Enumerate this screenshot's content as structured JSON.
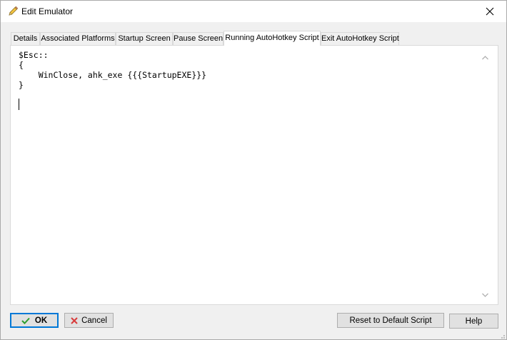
{
  "window": {
    "title": "Edit Emulator",
    "title_icon": "pencil-icon",
    "close_icon": "close-icon"
  },
  "tabs": [
    {
      "label": "Details",
      "active": false
    },
    {
      "label": "Associated Platforms",
      "active": false
    },
    {
      "label": "Startup Screen",
      "active": false
    },
    {
      "label": "Pause Screen",
      "active": false
    },
    {
      "label": "Running AutoHotkey Script",
      "active": true
    },
    {
      "label": "Exit AutoHotkey Script",
      "active": false
    }
  ],
  "editor": {
    "lines": [
      "$Esc::",
      "{",
      "    WinClose, ahk_exe {{{StartupEXE}}}",
      "}"
    ]
  },
  "buttons": {
    "ok": {
      "label": "OK",
      "icon": "checkmark-icon",
      "icon_color": "#2e9e2e"
    },
    "cancel": {
      "label": "Cancel",
      "icon": "x-icon",
      "icon_color": "#d83b3b"
    },
    "reset": {
      "label": "Reset to Default Script"
    },
    "help": {
      "label": "Help"
    }
  },
  "colors": {
    "focus_border": "#0078d7",
    "panel_bg": "#ffffff",
    "window_bg": "#f0f0f0"
  }
}
